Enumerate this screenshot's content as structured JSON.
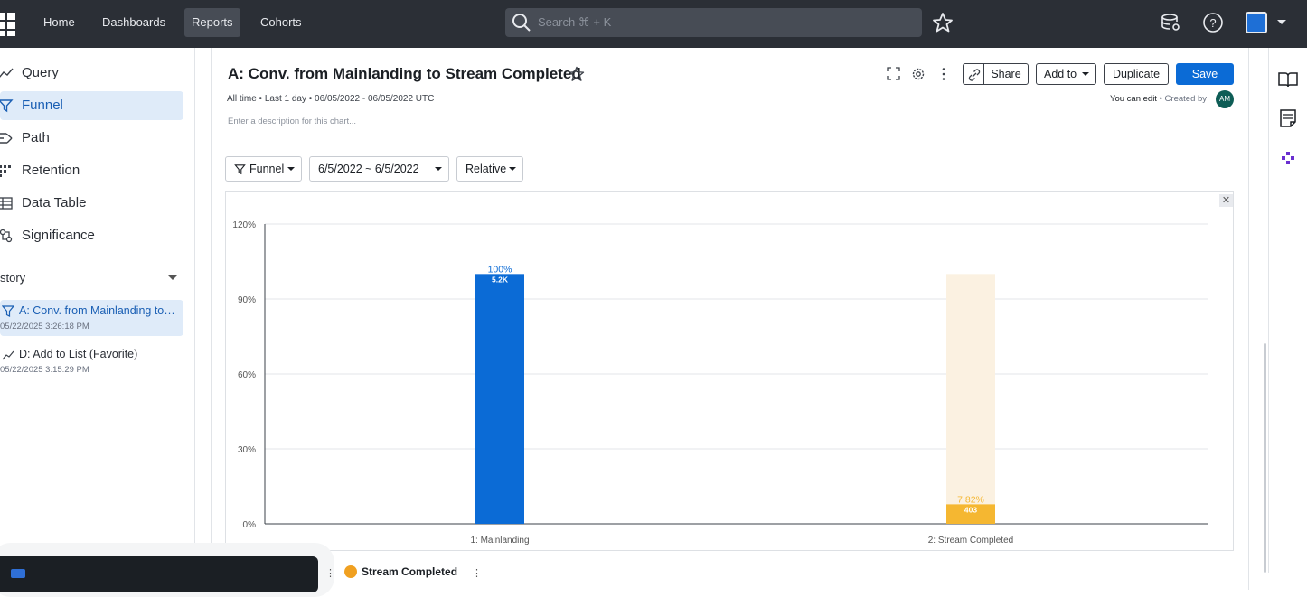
{
  "nav": {
    "items": [
      {
        "label": "Home"
      },
      {
        "label": "Dashboards"
      },
      {
        "label": "Reports"
      },
      {
        "label": "Cohorts"
      }
    ],
    "search_placeholder": "Search ⌘ + K"
  },
  "sidebar": {
    "items": [
      {
        "label": "Query",
        "icon": "query-line-icon"
      },
      {
        "label": "Funnel",
        "icon": "funnel-icon"
      },
      {
        "label": "Path",
        "icon": "path-icon"
      },
      {
        "label": "Retention",
        "icon": "retention-grid-icon"
      },
      {
        "label": "Data Table",
        "icon": "table-icon"
      },
      {
        "label": "Significance",
        "icon": "significance-icon"
      }
    ],
    "history_label": "story",
    "history": [
      {
        "title": "A: Conv. from Mainlanding to Stream Completed",
        "date": "05/22/2025 3:26:18 PM"
      },
      {
        "title": "D: Add to List (Favorite)",
        "date": "05/22/2025 3:15:29 PM"
      }
    ]
  },
  "report": {
    "title": "A: Conv. from Mainlanding to Stream Completed",
    "subtitle": "All time • Last 1 day • 06/05/2022 - 06/05/2022 UTC",
    "description_placeholder": "Enter a description for this chart...",
    "share_label": "Share",
    "add_to_label": "Add to",
    "duplicate_label": "Duplicate",
    "save_label": "Save",
    "edit_note": "You can edit",
    "created_by": "• Created by",
    "avatar_initials": "AM"
  },
  "controls": {
    "funnel_label": "Funnel",
    "date_range": "6/5/2022 ~ 6/5/2022",
    "mode_label": "Relative"
  },
  "legend_peek": "Stream Completed",
  "colors": {
    "topbar": "#2b2f36",
    "accent": "#0b6bd6",
    "bar_step1": "#0b6bd6",
    "bar_step2": "#f5b731",
    "bar_step2_dropoff": "#fbf1e1"
  },
  "chart_data": {
    "type": "bar",
    "categories": [
      "1: Mainlanding",
      "2: Stream Completed"
    ],
    "values": [
      100,
      7.82
    ],
    "percent_labels": [
      "100%",
      "7.82%"
    ],
    "count_labels": [
      "5.2K",
      "403"
    ],
    "y_ticks": [
      "0%",
      "30%",
      "60%",
      "90%",
      "120%"
    ],
    "ylim": [
      0,
      120
    ],
    "grid": true
  }
}
